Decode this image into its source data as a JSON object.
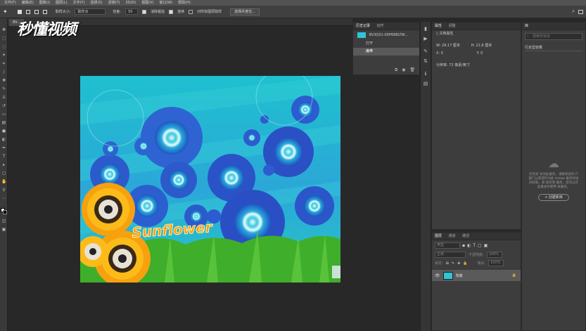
{
  "menubar": {
    "items": [
      "文件(F)",
      "编辑(E)",
      "图像(I)",
      "图层(L)",
      "文字(Y)",
      "选择(S)",
      "滤镜(T)",
      "3D(D)",
      "视图(V)",
      "窗口(W)",
      "帮助(H)"
    ]
  },
  "options_bar": {
    "sample_size_label": "取样大小:",
    "sample_size_value": "取样点",
    "tolerance_label": "容差:",
    "tolerance_value": "50",
    "antialias_label": "消除锯齿",
    "contiguous_label": "连续",
    "sample_all_label": "对所有图层取样",
    "select_and_mask_label": "选择并遮住..."
  },
  "document": {
    "tab_title": "8V..."
  },
  "watermark": {
    "text": "秒懂视频"
  },
  "canvas_art": {
    "title_text": "Sunflower"
  },
  "history_panel": {
    "tabs": [
      "历史记录",
      "动作"
    ],
    "snapshot_label": "8V3Q31-00P688LTW...",
    "items": [
      "打开",
      "魔棒"
    ]
  },
  "properties_panel": {
    "tabs": [
      "属性",
      "调整"
    ],
    "doc_label": "文档属性",
    "width_label": "W:",
    "width_value": "29.17 厘米",
    "height_label": "H:",
    "height_value": "21.8 厘米",
    "x_label": "X:",
    "x_value": "0",
    "y_label": "Y:",
    "y_value": "0",
    "resolution": "分辨率: 72 像素/英寸"
  },
  "layers_panel": {
    "tabs": [
      "图层",
      "通道",
      "路径"
    ],
    "filter_label": "类型",
    "blend_mode": "正常",
    "opacity_label": "不透明度:",
    "opacity_value": "100%",
    "lock_label": "锁定:",
    "fill_label": "填充:",
    "fill_value": "100%",
    "layer_name": "背景"
  },
  "library_panel": {
    "tab": "库",
    "search_placeholder": "搜索所有库",
    "dropdown": "行走型窗着",
    "offline_message": "仅先初 访问此服务，请联系您的 IT 部门以获得针对此 Adobe 服务的访问权限，或 接近到  服务，您可以在此模式中使用 本服务。",
    "create_button": "+ 创建新库"
  },
  "colors": {
    "accent": "#4a8fd8",
    "canvas_sky": "#2ec5d8",
    "grass": "#3fae2a"
  }
}
